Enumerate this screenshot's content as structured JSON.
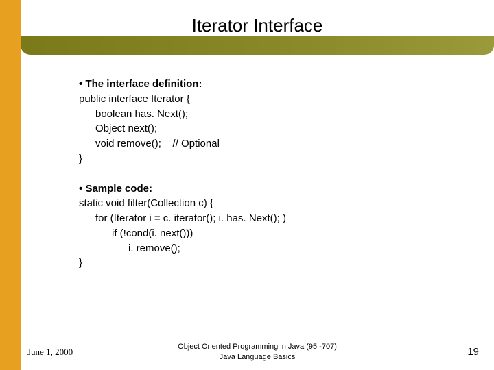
{
  "title": "Iterator Interface",
  "section1": {
    "bullet": "•",
    "head": "The interface definition:",
    "line1": "public interface Iterator {",
    "line2": "boolean has. Next();",
    "line3": "Object next();",
    "line4": "void remove();",
    "line4_comment": "// Optional",
    "line5": "}"
  },
  "section2": {
    "bullet": "•",
    "head": "Sample code:",
    "line1": "static void filter(Collection c) {",
    "line2": "for (Iterator i = c. iterator(); i. has. Next(); )",
    "line3": "if (!cond(i. next()))",
    "line4": "i. remove();",
    "line5": "}"
  },
  "footer": {
    "date": "June 1, 2000",
    "center_line1": "Object Oriented Programming in Java  (95 -707)",
    "center_line2": "Java Language Basics",
    "page": "19"
  }
}
